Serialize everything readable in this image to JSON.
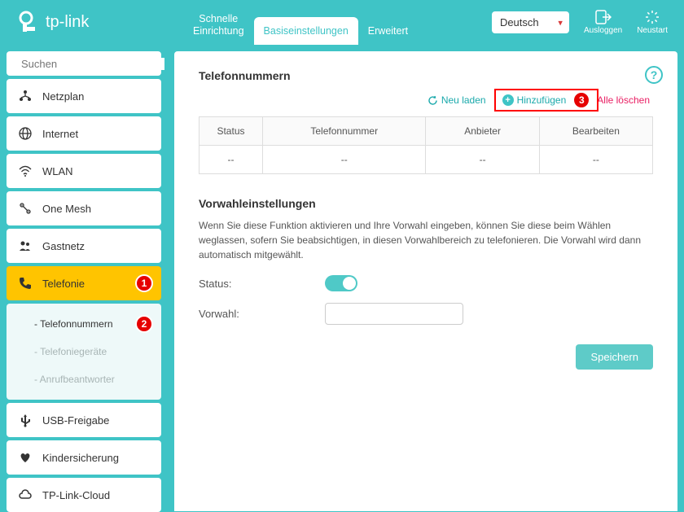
{
  "brand": "tp-link",
  "topnav": {
    "quick": "Schnelle\nEinrichtung",
    "basic": "Basiseinstellungen",
    "advanced": "Erweitert"
  },
  "header": {
    "language": "Deutsch",
    "logout": "Ausloggen",
    "restart": "Neustart"
  },
  "search": {
    "placeholder": "Suchen"
  },
  "sidebar": {
    "netzplan": "Netzplan",
    "internet": "Internet",
    "wlan": "WLAN",
    "onemesh": "One Mesh",
    "gastnetz": "Gastnetz",
    "telefonie": "Telefonie",
    "sub_telefonnummern": "- Telefonnummern",
    "sub_geraete": "- Telefoniegeräte",
    "sub_ab": "- Anrufbeantworter",
    "usb": "USB-Freigabe",
    "kinder": "Kindersicherung",
    "cloud": "TP-Link-Cloud"
  },
  "badges": {
    "one": "1",
    "two": "2",
    "three": "3"
  },
  "content": {
    "title1": "Telefonnummern",
    "reload": "Neu laden",
    "add": "Hinzufügen",
    "delete_all": "Alle löschen",
    "table": {
      "headers": [
        "Status",
        "Telefonnummer",
        "Anbieter",
        "Bearbeiten"
      ],
      "row": [
        "--",
        "--",
        "--",
        "--"
      ]
    },
    "title2": "Vorwahleinstellungen",
    "desc": "Wenn Sie diese Funktion aktivieren und Ihre Vorwahl eingeben, können Sie diese beim Wählen weglassen, sofern Sie beabsichtigen, in diesen Vorwahlbereich zu telefonieren. Die Vorwahl wird dann automatisch mitgewählt.",
    "status_label": "Status:",
    "vorwahl_label": "Vorwahl:",
    "save": "Speichern"
  }
}
